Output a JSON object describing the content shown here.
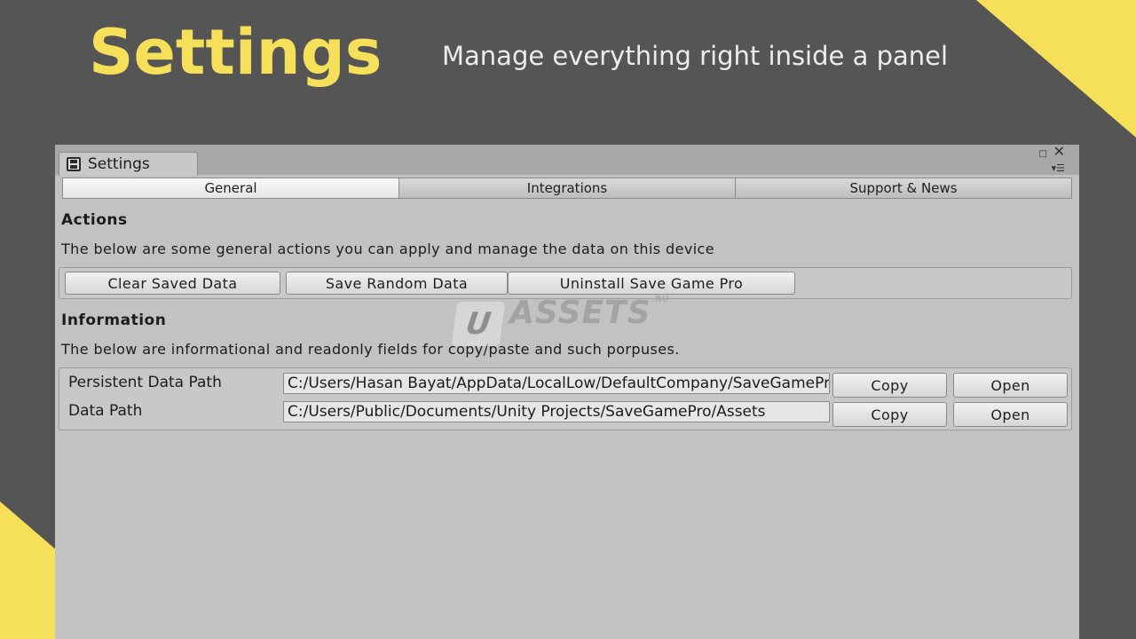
{
  "hero": {
    "title": "Settings",
    "subtitle": "Manage everything right inside a panel"
  },
  "window": {
    "tab_label": "Settings",
    "icons": {
      "tab": "floppy-disk-icon",
      "maximize": "maximize-icon",
      "close": "close-icon",
      "menu": "context-menu-icon"
    }
  },
  "toolbar": {
    "tabs": [
      {
        "label": "General",
        "active": true
      },
      {
        "label": "Integrations",
        "active": false
      },
      {
        "label": "Support & News",
        "active": false
      }
    ]
  },
  "actions": {
    "title": "Actions",
    "description": "The below are some general actions you can apply and manage the data on this device",
    "buttons": {
      "clear": "Clear Saved Data",
      "random": "Save Random Data",
      "uninstall": "Uninstall Save Game Pro"
    }
  },
  "information": {
    "title": "Information",
    "description": "The below are informational and readonly fields for copy/paste and such porpuses.",
    "fields": [
      {
        "label": "Persistent Data Path",
        "value": "C:/Users/Hasan Bayat/AppData/LocalLow/DefaultCompany/SaveGamePro",
        "copy": "Copy",
        "open": "Open"
      },
      {
        "label": "Data Path",
        "value": "C:/Users/Public/Documents/Unity Projects/SaveGamePro/Assets",
        "copy": "Copy",
        "open": "Open"
      }
    ]
  },
  "watermark": {
    "letter": "U",
    "text": "ASSETS",
    "suffix": ".RU"
  },
  "colors": {
    "background": "#555555",
    "accent": "#f6e05a",
    "panel": "#c2c2c2"
  }
}
